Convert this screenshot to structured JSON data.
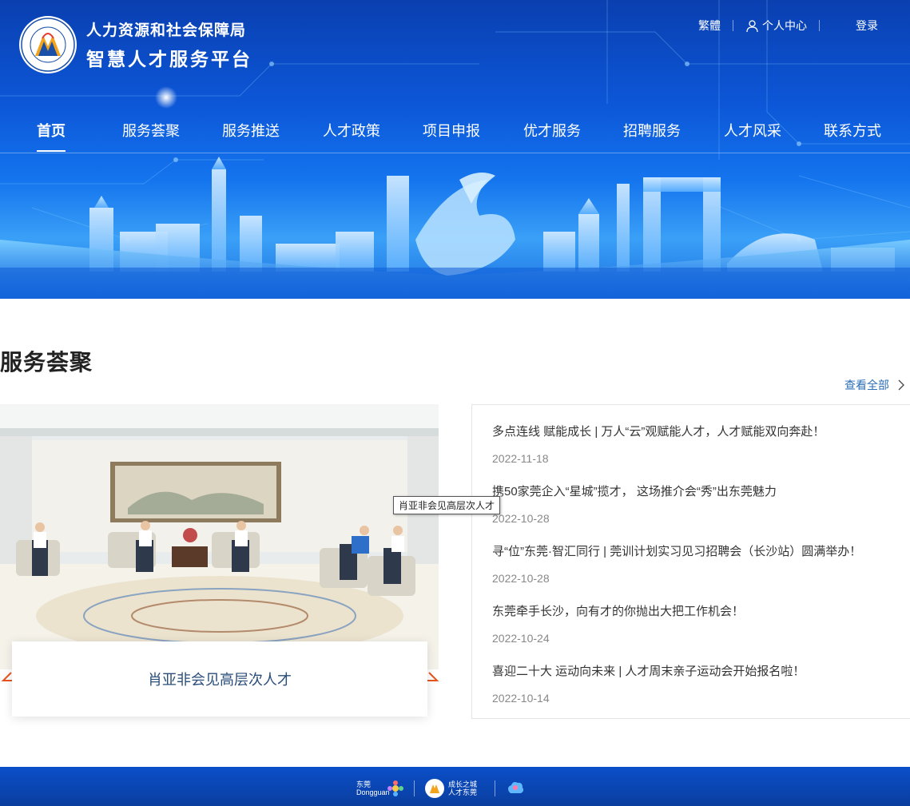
{
  "header": {
    "org_name": "人力资源和社会保障局",
    "platform_name": "智慧人才服务平台",
    "top_links": {
      "traditional": "繁體",
      "personal_center": "个人中心",
      "login": "登录"
    }
  },
  "nav": {
    "items": [
      {
        "label": "首页",
        "active": true
      },
      {
        "label": "服务荟聚",
        "active": false
      },
      {
        "label": "服务推送",
        "active": false
      },
      {
        "label": "人才政策",
        "active": false
      },
      {
        "label": "项目申报",
        "active": false
      },
      {
        "label": "优才服务",
        "active": false
      },
      {
        "label": "招聘服务",
        "active": false
      },
      {
        "label": "人才风采",
        "active": false
      },
      {
        "label": "联系方式",
        "active": false
      }
    ]
  },
  "section": {
    "title": "服务荟聚",
    "view_all": "查看全部",
    "featured_caption": "肖亚非会见高层次人才",
    "tooltip": "肖亚非会见高层次人才"
  },
  "news": [
    {
      "title": "多点连线 赋能成长 | 万人“云”观赋能人才，人才赋能双向奔赴！",
      "date": "2022-11-18"
    },
    {
      "title": "携50家莞企入“星城”揽才， 这场推介会“秀”出东莞魅力",
      "date": "2022-10-28"
    },
    {
      "title": "寻“位”东莞·智汇同行 | 莞训计划实习见习招聘会（长沙站）圆满举办！",
      "date": "2022-10-28"
    },
    {
      "title": "东莞牵手长沙，向有才的你抛出大把工作机会！",
      "date": "2022-10-24"
    },
    {
      "title": "喜迎二十大 运动向未来 | 人才周末亲子运动会开始报名啦！",
      "date": "2022-10-14"
    }
  ],
  "footer": {
    "logo1_text": "东莞 Dongguan",
    "logo2_text": "成长之城 人才东莞"
  },
  "colors": {
    "banner_blue": "#0c57d8",
    "link_blue": "#2b6fb6",
    "arrow_orange": "#e8541e"
  }
}
